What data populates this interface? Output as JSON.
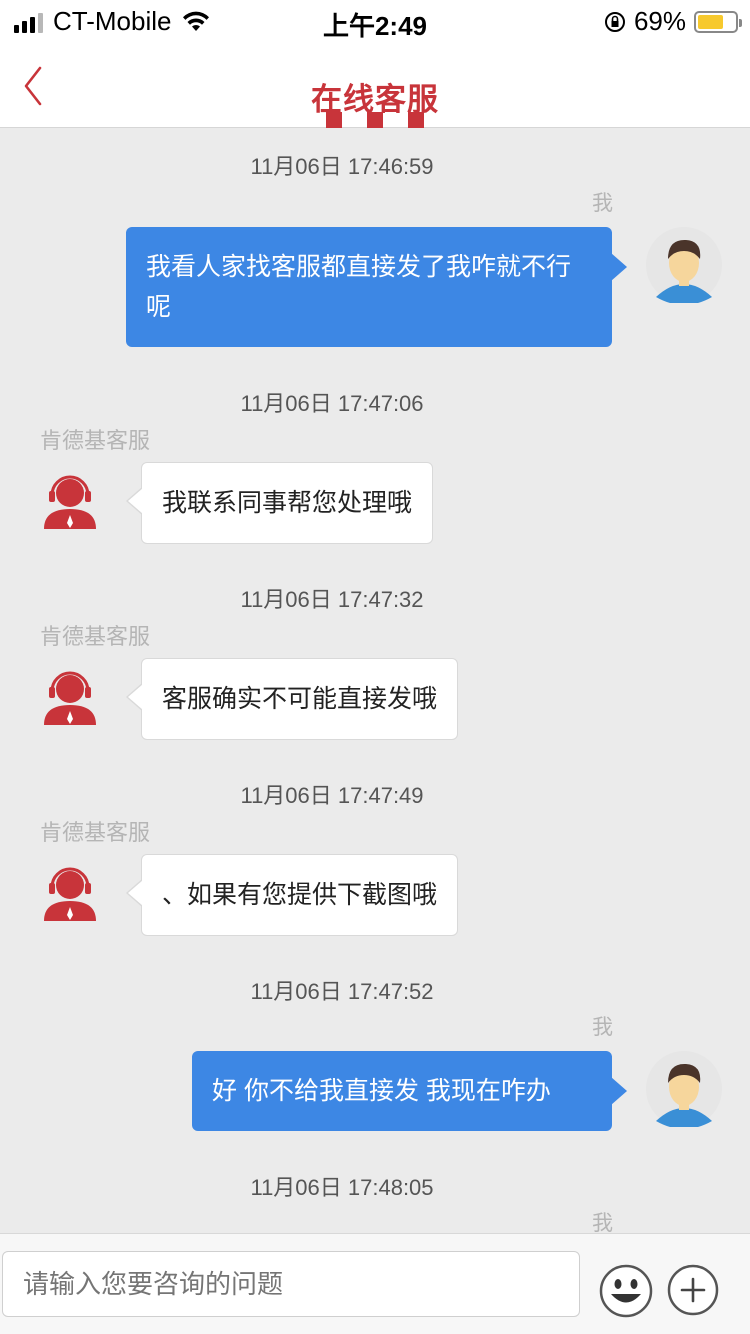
{
  "status": {
    "carrier": "CT-Mobile",
    "time": "上午2:49",
    "battery_pct": "69%",
    "battery_level": 0.69
  },
  "header": {
    "title": "在线客服",
    "back_icon": "chevron-left-icon",
    "accent_color": "#c8343a"
  },
  "chat": {
    "me_label": "我",
    "agent_label": "肯德基客服",
    "messages": [
      {
        "time": "11月06日 17:46:59",
        "from": "me",
        "text": "我看人家找客服都直接发了我咋就不行呢"
      },
      {
        "time": "11月06日 17:47:06",
        "from": "agent",
        "text": "我联系同事帮您处理哦"
      },
      {
        "time": "11月06日 17:47:32",
        "from": "agent",
        "text": "客服确实不可能直接发哦"
      },
      {
        "time": "11月06日 17:47:49",
        "from": "agent",
        "text": "、如果有您提供下截图哦"
      },
      {
        "time": "11月06日 17:47:52",
        "from": "me",
        "text": "好 你不给我直接发 我现在咋办"
      },
      {
        "time": "11月06日 17:48:05",
        "from": "me",
        "text": ""
      }
    ]
  },
  "composer": {
    "placeholder": "请输入您要咨询的问题",
    "emoji_icon": "smiley-icon",
    "plus_icon": "plus-circle-icon"
  },
  "colors": {
    "my_bubble": "#3d87e4",
    "agent_bubble": "#ffffff",
    "background": "#ebebeb"
  }
}
